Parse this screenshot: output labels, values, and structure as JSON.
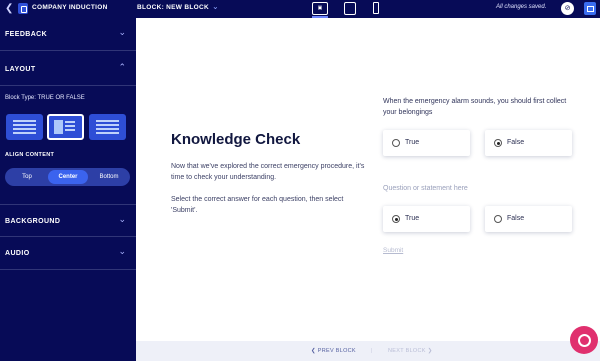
{
  "topbar": {
    "back_icon": "chevron-left-icon",
    "logo_icon": "course-logo-icon",
    "title": "COMPANY INDUCTION",
    "block_label": "BLOCK: NEW BLOCK",
    "device_desktop": "desktop-icon",
    "device_tablet": "tablet-icon",
    "device_phone": "phone-icon",
    "saved_status": "All changes saved.",
    "preview_icon": "eye-off-icon",
    "export_icon": "export-icon"
  },
  "sidebar": {
    "sections": {
      "feedback": "FEEDBACK",
      "layout": "LAYOUT",
      "background": "BACKGROUND",
      "audio": "AUDIO"
    },
    "block_type": "Block Type: TRUE OR FALSE",
    "align_content_label": "ALIGN CONTENT",
    "align_options": [
      "Top",
      "Center",
      "Bottom"
    ],
    "align_selected": "Center",
    "layout_selected_index": 1
  },
  "content": {
    "title": "Knowledge Check",
    "paragraph1": "Now that we've explored the correct emergency procedure, it's time to check your understanding.",
    "paragraph2": "Select the correct answer for each question, then select 'Submit'.",
    "questions": [
      {
        "text": "When the emergency alarm sounds, you should first collect your belongings",
        "options": [
          "True",
          "False"
        ],
        "selected": "False"
      },
      {
        "text": "Question or statement here",
        "options": [
          "True",
          "False"
        ],
        "selected": "True"
      }
    ],
    "submit_label": "Submit"
  },
  "nav": {
    "prev_label": "PREV BLOCK",
    "divider": "|",
    "next_label": "NEXT BLOCK"
  },
  "colors": {
    "sidebar_bg": "#070b57",
    "accent": "#3b63ee",
    "fab": "#e0306e"
  }
}
